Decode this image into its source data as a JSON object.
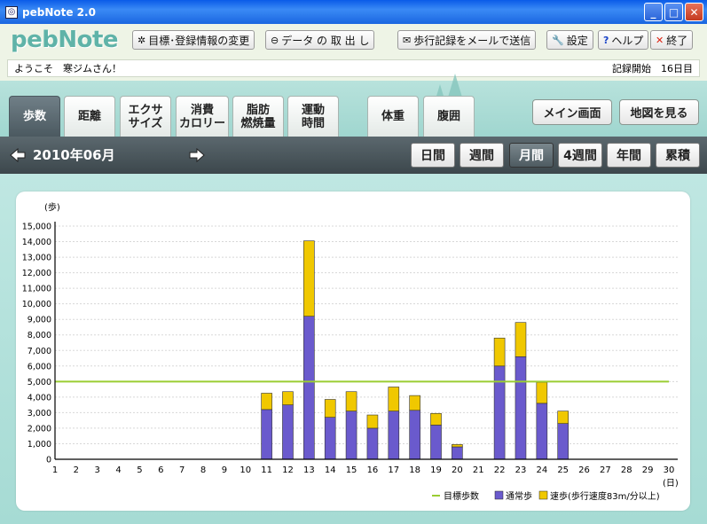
{
  "window": {
    "title": "pebNote 2.0"
  },
  "logo": {
    "text": "pebNote"
  },
  "toolbar": {
    "goal_label": "目標･登録情報の変更",
    "data_label": "データ の 取 出 し",
    "mail_label": "歩行記録をメールで送信",
    "settings_label": "設定",
    "help_label": "ヘルプ",
    "exit_label": "終了"
  },
  "welcome": {
    "greeting": "ようこそ　寒ジムさん！",
    "record_start": "記録開始　16日目"
  },
  "tabs": [
    {
      "l1": "歩数",
      "l2": ""
    },
    {
      "l1": "距離",
      "l2": ""
    },
    {
      "l1": "エクサ",
      "l2": "サイズ"
    },
    {
      "l1": "消費",
      "l2": "カロリー"
    },
    {
      "l1": "脂肪",
      "l2": "燃焼量"
    },
    {
      "l1": "運動",
      "l2": "時間"
    },
    {
      "l1": "体重",
      "l2": ""
    },
    {
      "l1": "腹囲",
      "l2": ""
    }
  ],
  "nav": {
    "main_label": "メイン画面",
    "map_label": "地図を見る"
  },
  "period": {
    "date": "2010年06月",
    "buttons": [
      "日間",
      "週間",
      "月間",
      "4週間",
      "年間",
      "累積"
    ],
    "active": "月間"
  },
  "colors": {
    "normal": "#6a5acd",
    "fast": "#f0c800",
    "goal": "#9acd32"
  },
  "chart_data": {
    "type": "bar",
    "stacked": true,
    "ylabel": "(歩)",
    "xlabel": "(日)",
    "ylim": [
      0,
      15000
    ],
    "ytick_step": 1000,
    "yticks": [
      "0",
      "1,000",
      "2,000",
      "3,000",
      "4,000",
      "5,000",
      "6,000",
      "7,000",
      "8,000",
      "9,000",
      "10,000",
      "11,000",
      "12,000",
      "13,000",
      "14,000",
      "15,000"
    ],
    "categories": [
      "1",
      "2",
      "3",
      "4",
      "5",
      "6",
      "7",
      "8",
      "9",
      "10",
      "11",
      "12",
      "13",
      "14",
      "15",
      "16",
      "17",
      "18",
      "19",
      "20",
      "21",
      "22",
      "23",
      "24",
      "25",
      "26",
      "27",
      "28",
      "29",
      "30"
    ],
    "goal": 5000,
    "series": [
      {
        "name": "通常歩",
        "values": [
          0,
          0,
          0,
          0,
          0,
          0,
          0,
          0,
          0,
          0,
          3200,
          3500,
          9200,
          2700,
          3100,
          2000,
          3100,
          3150,
          2200,
          800,
          0,
          6000,
          6600,
          3600,
          2300,
          0,
          0,
          0,
          0,
          0
        ]
      },
      {
        "name": "速歩(歩行速度83m/分以上)",
        "values": [
          0,
          0,
          0,
          0,
          0,
          0,
          0,
          0,
          0,
          0,
          1050,
          850,
          4850,
          1150,
          1250,
          850,
          1550,
          950,
          750,
          150,
          0,
          1800,
          2200,
          1350,
          800,
          0,
          0,
          0,
          0,
          0
        ]
      }
    ],
    "legend": [
      "目標歩数",
      "通常歩",
      "速歩(歩行速度83m/分以上)"
    ]
  }
}
